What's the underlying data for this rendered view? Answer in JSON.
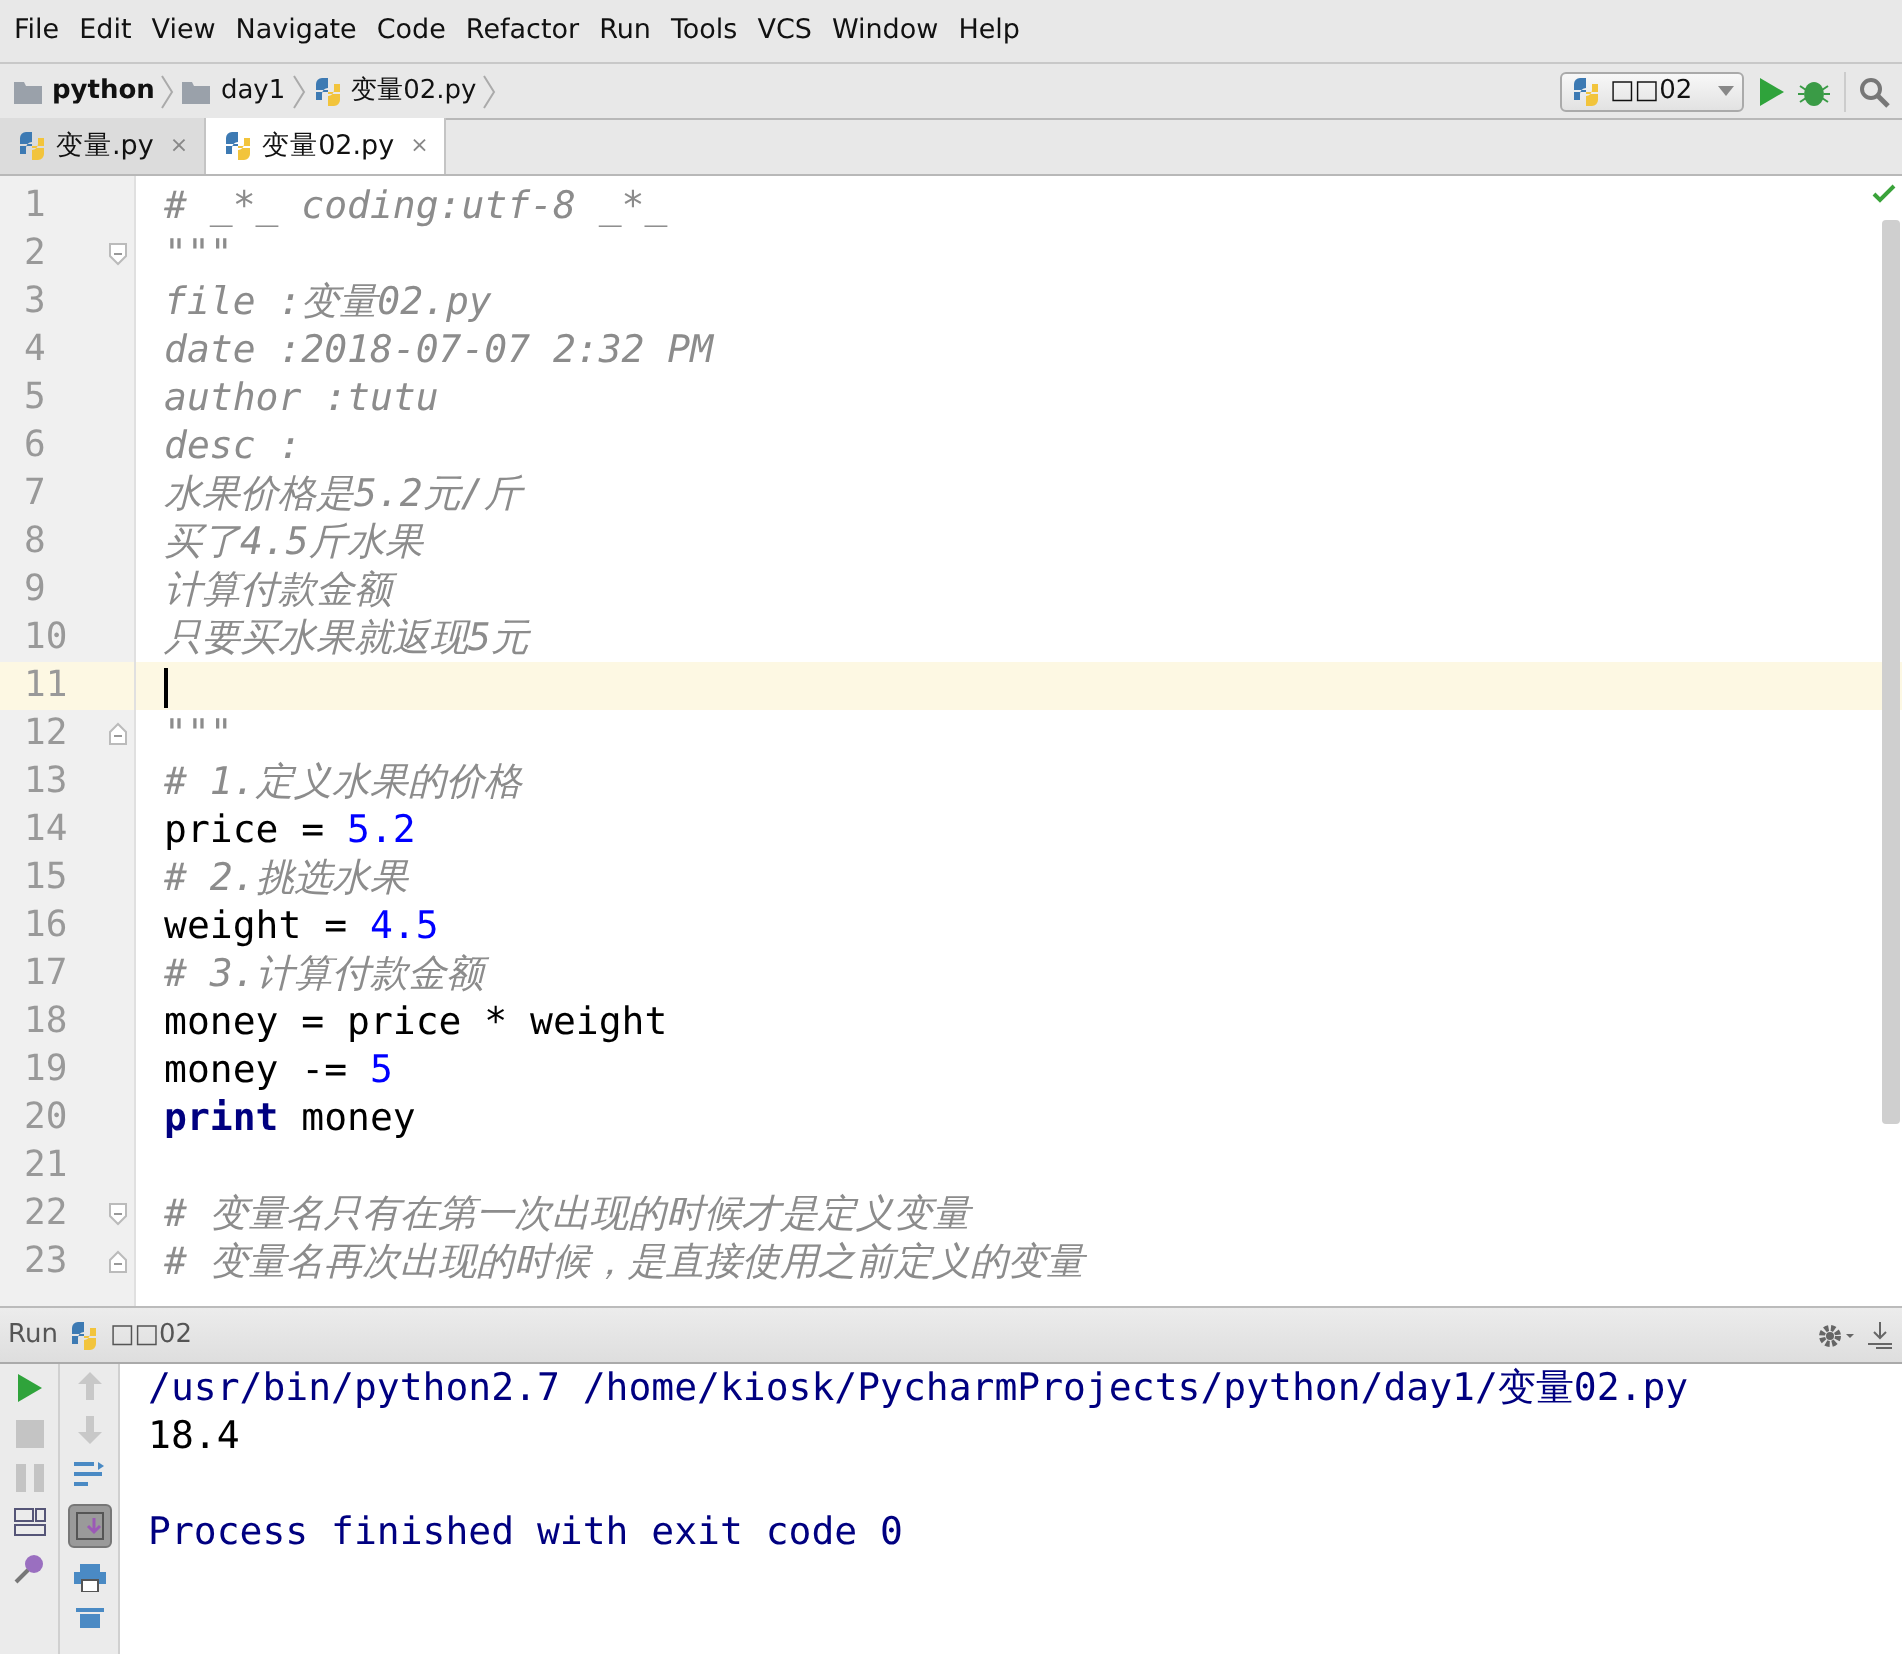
{
  "menu": [
    {
      "label": "File"
    },
    {
      "label": "Edit"
    },
    {
      "label": "View"
    },
    {
      "label": "Navigate"
    },
    {
      "label": "Code"
    },
    {
      "label": "Refactor"
    },
    {
      "label": "Run"
    },
    {
      "label": "Tools"
    },
    {
      "label": "VCS"
    },
    {
      "label": "Window"
    },
    {
      "label": "Help"
    }
  ],
  "breadcrumbs": [
    {
      "label": "python",
      "kind": "folder"
    },
    {
      "label": "day1",
      "kind": "folder"
    },
    {
      "label": "变量02.py",
      "kind": "file"
    }
  ],
  "run_config": "□□02",
  "tabs": [
    {
      "label": "变量.py",
      "close": "×",
      "selected": false
    },
    {
      "label": "变量02.py",
      "close": "×",
      "selected": true
    }
  ],
  "editor": {
    "lines": [
      {
        "number": "1",
        "tokens": [
          {
            "kind": "comment",
            "text": "# _*_ coding:utf-8 _*_"
          }
        ]
      },
      {
        "number": "2",
        "fold_start": true,
        "tokens": [
          {
            "kind": "comment",
            "text": "\"\"\""
          }
        ]
      },
      {
        "number": "3",
        "tokens": [
          {
            "kind": "comment",
            "text": "file :变量02.py"
          }
        ]
      },
      {
        "number": "4",
        "tokens": [
          {
            "kind": "comment",
            "text": "date :2018-07-07 2:32 PM"
          }
        ]
      },
      {
        "number": "5",
        "tokens": [
          {
            "kind": "comment",
            "text": "author :tutu"
          }
        ]
      },
      {
        "number": "6",
        "tokens": [
          {
            "kind": "comment",
            "text": "desc :"
          }
        ]
      },
      {
        "number": "7",
        "tokens": [
          {
            "kind": "comment",
            "text": "水果价格是5.2元/斤"
          }
        ]
      },
      {
        "number": "8",
        "tokens": [
          {
            "kind": "comment",
            "text": "买了4.5斤水果"
          }
        ]
      },
      {
        "number": "9",
        "tokens": [
          {
            "kind": "comment",
            "text": "计算付款金额"
          }
        ]
      },
      {
        "number": "10",
        "tokens": [
          {
            "kind": "comment",
            "text": "只要买水果就返现5元"
          }
        ]
      },
      {
        "number": "11",
        "current": true
      },
      {
        "number": "12",
        "fold_end": true,
        "tokens": [
          {
            "kind": "comment",
            "text": "\"\"\""
          }
        ]
      },
      {
        "number": "13",
        "tokens": [
          {
            "kind": "comment",
            "text": "# 1.定义水果的价格"
          }
        ]
      },
      {
        "number": "14",
        "tokens": [
          {
            "kind": "plain",
            "text": "price = "
          },
          {
            "kind": "number",
            "text": "5.2"
          }
        ]
      },
      {
        "number": "15",
        "tokens": [
          {
            "kind": "comment",
            "text": "# 2.挑选水果"
          }
        ]
      },
      {
        "number": "16",
        "tokens": [
          {
            "kind": "plain",
            "text": "weight = "
          },
          {
            "kind": "number",
            "text": "4.5"
          }
        ]
      },
      {
        "number": "17",
        "tokens": [
          {
            "kind": "comment",
            "text": "# 3.计算付款金额"
          }
        ]
      },
      {
        "number": "18",
        "tokens": [
          {
            "kind": "plain",
            "text": "money = price * weight"
          }
        ]
      },
      {
        "number": "19",
        "tokens": [
          {
            "kind": "plain",
            "text": "money -= "
          },
          {
            "kind": "number",
            "text": "5"
          }
        ]
      },
      {
        "number": "20",
        "tokens": [
          {
            "kind": "keyword",
            "text": "print"
          },
          {
            "kind": "plain",
            "text": " money"
          }
        ]
      },
      {
        "number": "21"
      },
      {
        "number": "22",
        "fold_start": true,
        "tokens": [
          {
            "kind": "comment",
            "text": "# 变量名只有在第一次出现的时候才是定义变量"
          }
        ]
      },
      {
        "number": "23",
        "fold_end": true,
        "tokens": [
          {
            "kind": "comment",
            "text": "# 变量名再次出现的时候，是直接使用之前定义的变量"
          }
        ]
      }
    ]
  },
  "run": {
    "title": "Run",
    "config": "□□02",
    "output": [
      {
        "kind": "command",
        "text": "/usr/bin/python2.7 /home/kiosk/PycharmProjects/python/day1/变量02.py"
      },
      {
        "kind": "output",
        "text": "18.4"
      },
      {
        "kind": "status",
        "text": "Process finished with exit code 0"
      }
    ]
  }
}
